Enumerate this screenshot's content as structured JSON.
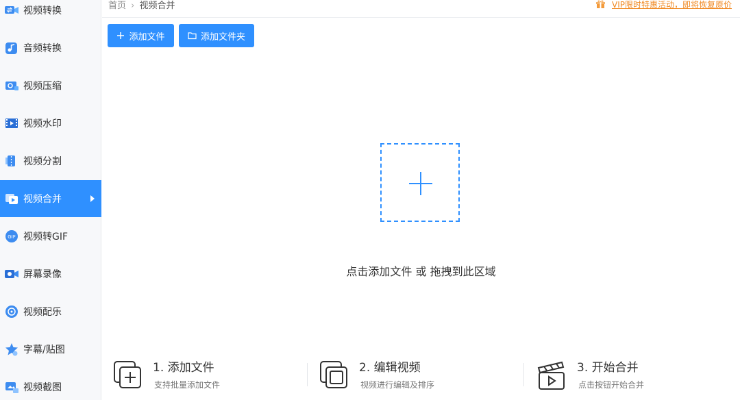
{
  "sidebar": {
    "items": [
      {
        "label": "视频转换",
        "icon": "video-convert-icon",
        "active": false
      },
      {
        "label": "音频转换",
        "icon": "audio-convert-icon",
        "active": false
      },
      {
        "label": "视频压缩",
        "icon": "video-compress-icon",
        "active": false
      },
      {
        "label": "视频水印",
        "icon": "video-watermark-icon",
        "active": false
      },
      {
        "label": "视频分割",
        "icon": "video-split-icon",
        "active": false
      },
      {
        "label": "视频合并",
        "icon": "video-merge-icon",
        "active": true
      },
      {
        "label": "视频转GIF",
        "icon": "video-to-gif-icon",
        "active": false
      },
      {
        "label": "屏幕录像",
        "icon": "screen-record-icon",
        "active": false
      },
      {
        "label": "视频配乐",
        "icon": "video-music-icon",
        "active": false
      },
      {
        "label": "字幕/贴图",
        "icon": "subtitle-sticker-icon",
        "active": false
      },
      {
        "label": "视频截图",
        "icon": "video-screenshot-icon",
        "active": false
      }
    ]
  },
  "header": {
    "breadcrumb_home": "首页",
    "breadcrumb_sep": "›",
    "breadcrumb_current": "视频合并",
    "promo": "VIP限时特惠活动，即将恢复原价"
  },
  "toolbar": {
    "add_file_label": "添加文件",
    "add_folder_label": "添加文件夹"
  },
  "dropzone": {
    "hint": "点击添加文件 或 拖拽到此区域"
  },
  "steps": [
    {
      "title": "1. 添加文件",
      "desc": "支持批量添加文件",
      "icon": "add-files-icon"
    },
    {
      "title": "2. 编辑视频",
      "desc": "视频进行编辑及排序",
      "icon": "edit-video-icon"
    },
    {
      "title": "3. 开始合并",
      "desc": "点击按钮开始合并",
      "icon": "clapperboard-icon"
    }
  ],
  "colors": {
    "accent": "#2f90ff",
    "promo": "#f08a24",
    "sidebar_bg": "#f7f8fa"
  }
}
